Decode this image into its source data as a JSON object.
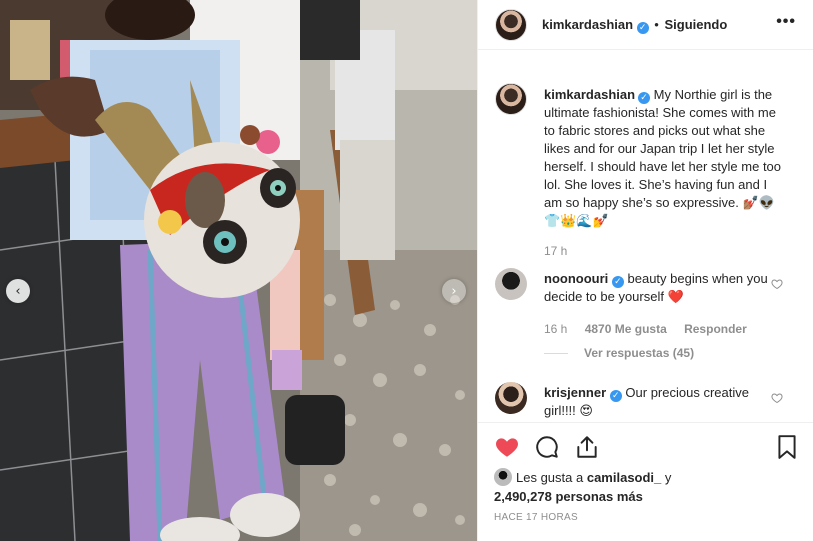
{
  "post": {
    "author": "kimkardashian",
    "follow_sep": "•",
    "follow_status": "Siguiendo",
    "more_icon": "•••",
    "caption": "My Northie girl is the ultimate fashionista! She comes with me to fabric stores and picks out what she likes and for our Japan trip I let her style herself. I should have let her style me too lol. She loves it. She’s having fun and I am so happy she’s so expressive. 💅🏽👽👕👑🌊💅",
    "caption_time": "17 h",
    "photo_nav": {
      "prev": "‹",
      "next": "›"
    }
  },
  "comments": [
    {
      "user": "noonoouri",
      "text": "beauty begins when you decide to be yourself ❤️",
      "time": "16 h",
      "likes": "4870 Me gusta",
      "reply": "Responder",
      "view_replies": "Ver respuestas (45)"
    },
    {
      "user": "krisjenner",
      "text": "Our precious creative girl!!!! 😍"
    }
  ],
  "likes": {
    "prefix": "Les gusta a",
    "first_user": "camilasodi_",
    "connector": "y",
    "others": "2,490,278 personas más"
  },
  "timestamp": "Hace 17 horas",
  "icons": {
    "like": "heart-icon",
    "comment": "comment-icon",
    "share": "share-icon",
    "save": "bookmark-icon"
  },
  "colors": {
    "like_red": "#ed4956",
    "verified_blue": "#3897f0",
    "muted_text": "#8e8e8e"
  }
}
